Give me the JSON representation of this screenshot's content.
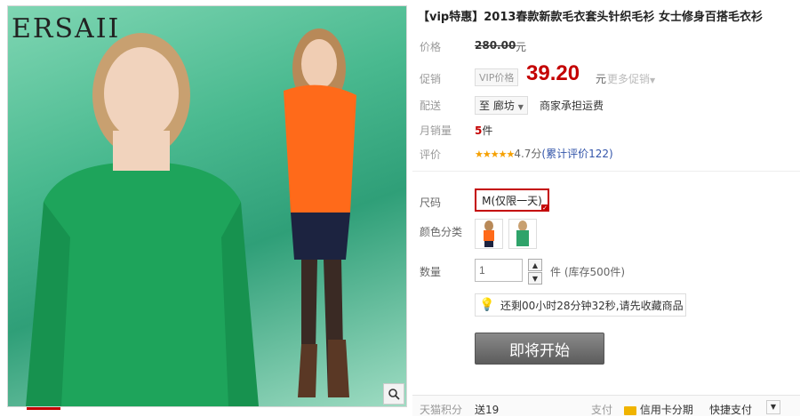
{
  "gallery": {
    "brand": "ERSAII",
    "zoom_icon": "magnifier-icon"
  },
  "product": {
    "title": "【vip特惠】2013春款新款毛衣套头针织毛衫 女士修身百搭毛衣衫"
  },
  "price_row": {
    "label": "价格",
    "original": "280.00",
    "unit": "元"
  },
  "promo_row": {
    "label": "促销",
    "tag": "VIP价格",
    "price": "39.20",
    "unit": "元",
    "more": "更多促销"
  },
  "delivery_row": {
    "label": "配送",
    "prefix": "至",
    "city": "廊坊",
    "note": "商家承担运费"
  },
  "sales_row": {
    "label": "月销量",
    "count": "5",
    "unit": "件"
  },
  "review_row": {
    "label": "评价",
    "stars": "★★★★★",
    "score": "4.7分",
    "reviews": "(累计评价122)"
  },
  "sku": {
    "size_label": "尺码",
    "size_value": "M(仅限一天)",
    "color_label": "颜色分类",
    "colors": [
      {
        "name": "orange",
        "hex": "#ff6a1a"
      },
      {
        "name": "green",
        "hex": "#2fa36a"
      }
    ],
    "qty_label": "数量",
    "qty_value": "1",
    "qty_unit": "件 (库存500件)",
    "notice": "还剩00小时28分钟32秒,请先收藏商品",
    "buy_button": "即将开始"
  },
  "footer": {
    "points_label": "天猫积分",
    "points_value": "送19",
    "pay_label": "支付",
    "credit": "信用卡分期",
    "quick": "快捷支付"
  },
  "colors": {
    "accent": "#c40000",
    "link": "#3355aa",
    "star": "#f5a000"
  }
}
